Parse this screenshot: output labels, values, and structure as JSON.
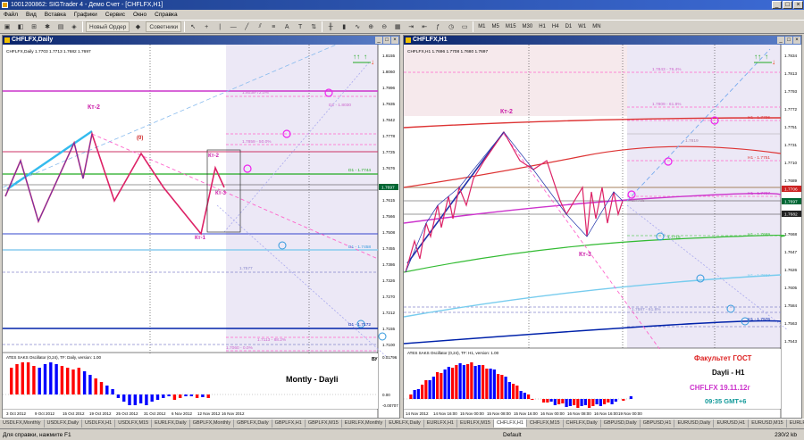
{
  "app": {
    "title": "1001200862: SIGTrader 4 - Демо Счет - [CHFLFX,H1]"
  },
  "menu": [
    "Файл",
    "Вид",
    "Вставка",
    "Графики",
    "Сервис",
    "Окно",
    "Справка"
  ],
  "toolbar": {
    "new_order": "Новый Ордер",
    "advisors": "Советники",
    "timeframes": [
      "M1",
      "M5",
      "M15",
      "M30",
      "H1",
      "H4",
      "D1",
      "W1",
      "MN"
    ]
  },
  "left_chart": {
    "title": "CHFLFX,Daily",
    "info": "CHFLFX,Daily 1.7703 1.7713 1.7682 1.7697",
    "yticks": [
      "1.8155",
      "1.8060",
      "1.7996",
      "1.7935",
      "1.7842",
      "1.7778",
      "1.7725",
      "1.7676",
      "1.7615",
      "1.7566",
      "1.7508",
      "1.7455",
      "1.7386",
      "1.7326",
      "1.7270",
      "1.7212",
      "1.7155",
      "1.7100",
      "1.7042"
    ],
    "levels": [
      "1.8038-72.0%",
      "D1 - 1.8030",
      "1.7859 - 50.0%",
      "D1 - 1.7744",
      "D1 - 1.7458",
      "1.7577",
      "D1 - 1.7172",
      "1.7113 - 88.2%",
      "1.7060 - 0.0%"
    ],
    "price_tag": "1.7697",
    "labels": [
      "Кт-2",
      "(0)",
      "Кт-2",
      "Кт-3",
      "Кт-1"
    ],
    "osc_title": "ATES SAKS Oscillator (0,24), TF: Daily, version: 1.00",
    "osc_yticks": [
      "0.01796",
      "0.00",
      "-0.00707"
    ],
    "xticks": [
      "3 Oct 2012",
      "9 Oct 2012",
      "15 Oct 2012",
      "19 Oct 2012",
      "25 Oct 2012",
      "31 Oct 2012",
      "6 Nov 2012",
      "12 Nov 2012",
      "16 Nov 2012"
    ],
    "note": "Montly - Dayli",
    "corner": "ВУ"
  },
  "right_chart": {
    "title": "CHFLFX,H1",
    "info": "CHFLFX,H1 1.7696 1.7708 1.7680 1.7697",
    "yticks": [
      "1.7834",
      "1.7813",
      "1.7793",
      "1.7772",
      "1.7751",
      "1.7731",
      "1.7710",
      "1.7689",
      "1.7668",
      "1.7647",
      "1.7626",
      "1.7605",
      "1.7584",
      "1.7563",
      "1.7543",
      "1.7522",
      "1.7501"
    ],
    "levels": [
      "1.7843 - 76.4%",
      "1.7809 - 61.8%",
      "H1 - 1.7796",
      "1.7819",
      "H1 - 1.7751",
      "1.7735",
      "H1 - 1.7707",
      "1.7715",
      "H1 - 1.7669",
      "H1 - 1.7667",
      "H1 - 1.7576",
      "1.7587 - 61.8%",
      "1.7526"
    ],
    "price_tags": [
      "1.7706",
      "1.7697",
      "1.7682"
    ],
    "labels": [
      "Кт-2",
      "Кт-3"
    ],
    "osc_title": "ATES SAKS Oscillator (0,24), TF: H1, version: 1.00",
    "xticks": [
      "14 Nov 2012",
      "14 Nov 16:00",
      "15 Nov 00:00",
      "15 Nov 08:00",
      "15 Nov 16:00",
      "16 Nov 00:00",
      "16 Nov 08:00",
      "16 Nov 16:00",
      "19 Nov 00:00"
    ],
    "info_box": {
      "school": "Факультет ГОСТ",
      "mode": "Dayli - H1",
      "symbol_date": "CHFLFX 19.11.12г",
      "time": "09:35 GMT+6"
    }
  },
  "tabs": [
    "USDLFX,Monthly",
    "USDLFX,Daily",
    "USDLFX,H1",
    "USDLFX,M15",
    "EURLFX,Daily",
    "GBPLFX,Monthly",
    "GBPLFX,Daily",
    "GBPLFX,H1",
    "GBPLFX,M15",
    "EURLFX,Monthly",
    "EURLFX,Daily",
    "EURLFX,H1",
    "EURLFX,M15",
    "CHFLFX,H1",
    "CHFLFX,M15",
    "CHFLFX,Daily",
    "GBPUSD,Daily",
    "GBPUSD,H1",
    "EURUSD,Daily",
    "EURUSD,H1",
    "EURUSD,M15",
    "EURLFX"
  ],
  "active_tab": "CHFLFX,H1",
  "status": {
    "help": "Для справки, нажмите F1",
    "profile": "Default",
    "traffic": "230/2 kb"
  },
  "colors": {
    "bg_tint": "#ece8f6",
    "up_bar": "#ff0000",
    "down_bar": "#0000ff",
    "fib_dash": "#ff66cc"
  }
}
